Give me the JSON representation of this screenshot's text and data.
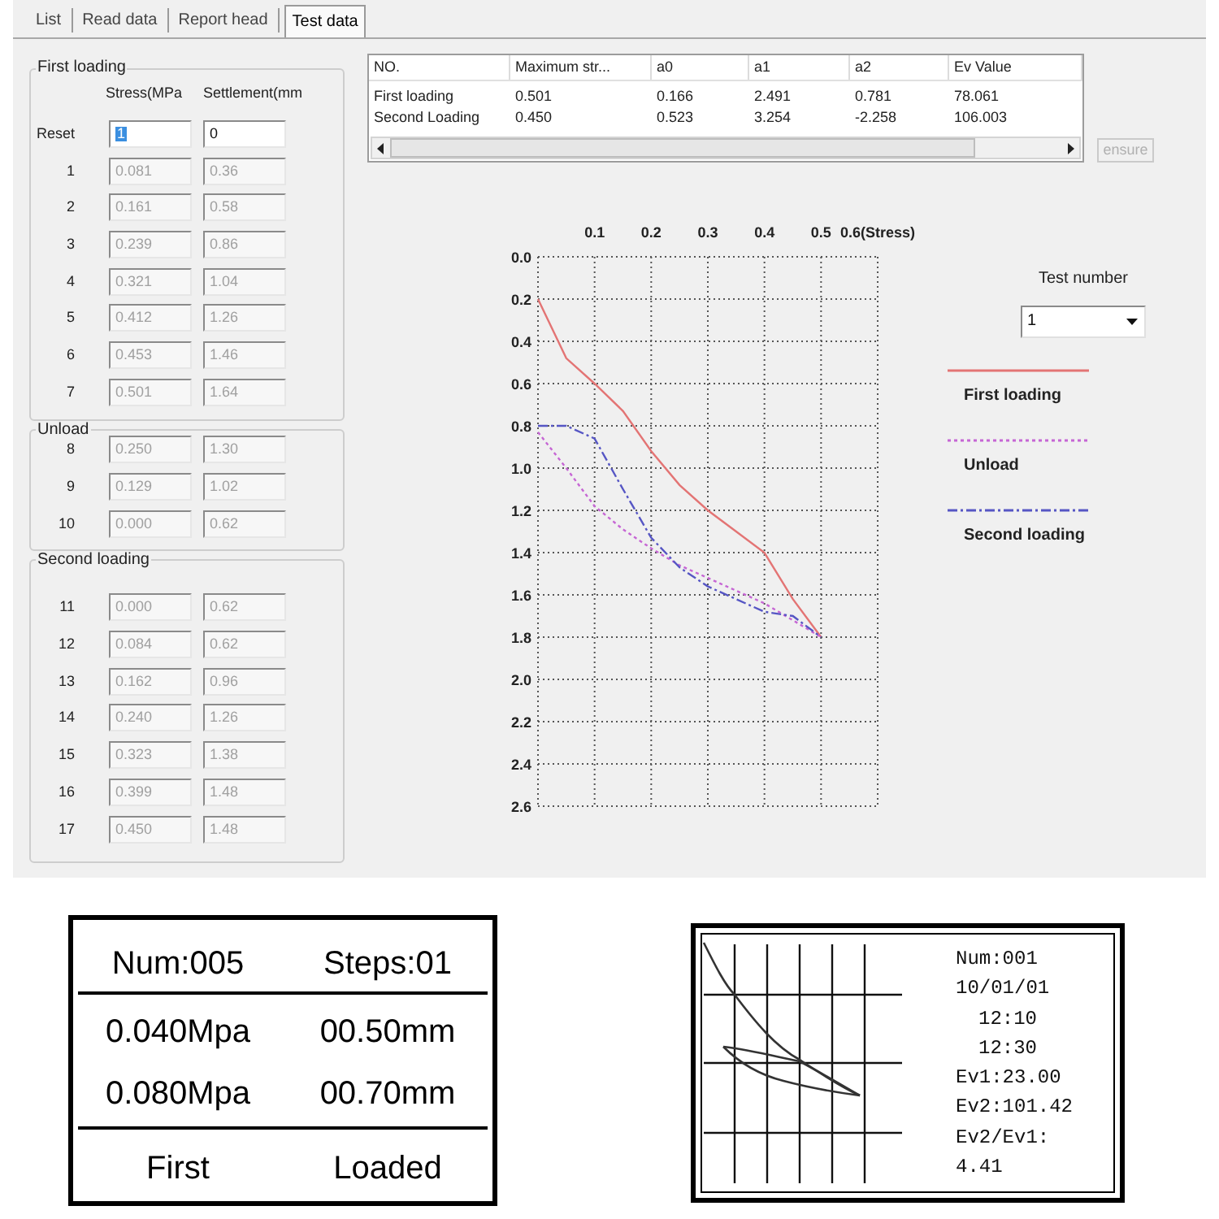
{
  "tabs": [
    {
      "label": "List",
      "selected": false
    },
    {
      "label": "Read data",
      "selected": false
    },
    {
      "label": "Report head",
      "selected": false
    },
    {
      "label": "Test data",
      "selected": true
    }
  ],
  "groups": [
    {
      "title": "First loading",
      "columns": [
        "Stress(MPa",
        "Settlement(mm"
      ],
      "rows": [
        {
          "label": "Reset",
          "stress": "1",
          "settlement": "0",
          "disabled": false,
          "highlighted": true
        },
        {
          "label": "1",
          "stress": "0.081",
          "settlement": "0.36",
          "disabled": true,
          "highlighted": false
        },
        {
          "label": "2",
          "stress": "0.161",
          "settlement": "0.58",
          "disabled": true,
          "highlighted": false
        },
        {
          "label": "3",
          "stress": "0.239",
          "settlement": "0.86",
          "disabled": true,
          "highlighted": false
        },
        {
          "label": "4",
          "stress": "0.321",
          "settlement": "1.04",
          "disabled": true,
          "highlighted": false
        },
        {
          "label": "5",
          "stress": "0.412",
          "settlement": "1.26",
          "disabled": true,
          "highlighted": false
        },
        {
          "label": "6",
          "stress": "0.453",
          "settlement": "1.46",
          "disabled": true,
          "highlighted": false
        },
        {
          "label": "7",
          "stress": "0.501",
          "settlement": "1.64",
          "disabled": true,
          "highlighted": false
        }
      ]
    },
    {
      "title": "Unload",
      "rows": [
        {
          "label": "8",
          "stress": "0.250",
          "settlement": "1.30",
          "disabled": true,
          "highlighted": false
        },
        {
          "label": "9",
          "stress": "0.129",
          "settlement": "1.02",
          "disabled": true,
          "highlighted": false
        },
        {
          "label": "10",
          "stress": "0.000",
          "settlement": "0.62",
          "disabled": true,
          "highlighted": false
        }
      ]
    },
    {
      "title": "Second loading",
      "rows": [
        {
          "label": "11",
          "stress": "0.000",
          "settlement": "0.62",
          "disabled": true,
          "highlighted": false
        },
        {
          "label": "12",
          "stress": "0.084",
          "settlement": "0.62",
          "disabled": true,
          "highlighted": false
        },
        {
          "label": "13",
          "stress": "0.162",
          "settlement": "0.96",
          "disabled": true,
          "highlighted": false
        },
        {
          "label": "14",
          "stress": "0.240",
          "settlement": "1.26",
          "disabled": true,
          "highlighted": false
        },
        {
          "label": "15",
          "stress": "0.323",
          "settlement": "1.38",
          "disabled": true,
          "highlighted": false
        },
        {
          "label": "16",
          "stress": "0.399",
          "settlement": "1.48",
          "disabled": true,
          "highlighted": false
        },
        {
          "label": "17",
          "stress": "0.450",
          "settlement": "1.48",
          "disabled": true,
          "highlighted": false
        }
      ]
    }
  ],
  "test_data": {
    "table": {
      "columns": [
        "NO.",
        "Maximum str...",
        "a0",
        "a1",
        "a2",
        "Ev Value"
      ],
      "rows": [
        [
          "First loading",
          "0.501",
          "0.166",
          "2.491",
          "0.781",
          "78.061"
        ],
        [
          "Second Loading",
          "0.450",
          "0.523",
          "3.254",
          "-2.258",
          "106.003"
        ]
      ]
    },
    "ensure_button": {
      "label": "ensure",
      "disabled": true
    },
    "chart_data": {
      "type": "line",
      "grid": true,
      "x": [
        0,
        0.05,
        0.1,
        0.15,
        0.2,
        0.25,
        0.3,
        0.35,
        0.4,
        0.45,
        0.5
      ],
      "series": [
        {
          "name": "First loading",
          "color": "#e37474",
          "line_style": "solid",
          "values": [
            0.2,
            0.48,
            0.6,
            0.73,
            0.92,
            1.08,
            1.2,
            1.3,
            1.4,
            1.62,
            1.8
          ]
        },
        {
          "name": "Unload",
          "color": "#c666d4",
          "line_style": "dotted",
          "values": [
            0.83,
            1.0,
            1.18,
            1.29,
            1.38,
            1.46,
            1.52,
            1.58,
            1.64,
            1.72,
            1.8
          ]
        },
        {
          "name": "Second loading",
          "color": "#5656c4",
          "line_style": "dashdot",
          "values": [
            0.8,
            0.8,
            0.86,
            1.1,
            1.33,
            1.47,
            1.56,
            1.62,
            1.68,
            1.7,
            1.8
          ]
        }
      ],
      "xlim": [
        0,
        0.6
      ],
      "ylim": [
        2.6,
        0
      ],
      "xticks": [
        0.1,
        0.2,
        0.3,
        0.4,
        0.5,
        {
          "value": 0.6,
          "label": "0.6(Stress)"
        }
      ],
      "yticks": [
        {
          "value": 0,
          "label": "0.0"
        },
        0.2,
        0.4,
        0.6,
        0.8,
        {
          "value": 1,
          "label": "1.0"
        },
        1.2,
        1.4,
        1.6,
        1.8,
        {
          "value": 2,
          "label": "2.0"
        },
        2.2,
        2.4,
        2.6
      ]
    },
    "test_number": {
      "label": "Test number",
      "value": "1"
    }
  },
  "lcd_display": {
    "rows": [
      [
        "Num:005",
        "Steps:01"
      ],
      [
        "0.040Mpa",
        "00.50mm"
      ],
      [
        "0.080Mpa",
        "00.70mm"
      ],
      [
        "First",
        "Loaded"
      ]
    ]
  },
  "printout": {
    "lines": [
      {
        "text": "Num:001",
        "kind": "plain"
      },
      {
        "text": "10/01/01",
        "kind": "plain"
      },
      {
        "text": "12:10",
        "kind": "indented"
      },
      {
        "text": "12:30",
        "kind": "indented"
      },
      {
        "text": "Ev1:23.00",
        "kind": "plain"
      },
      {
        "text": "Ev2:101.42",
        "kind": "plain"
      },
      {
        "text": "Ev2/Ev1:",
        "kind": "plain"
      },
      {
        "text": "4.41",
        "kind": "plain"
      }
    ]
  }
}
